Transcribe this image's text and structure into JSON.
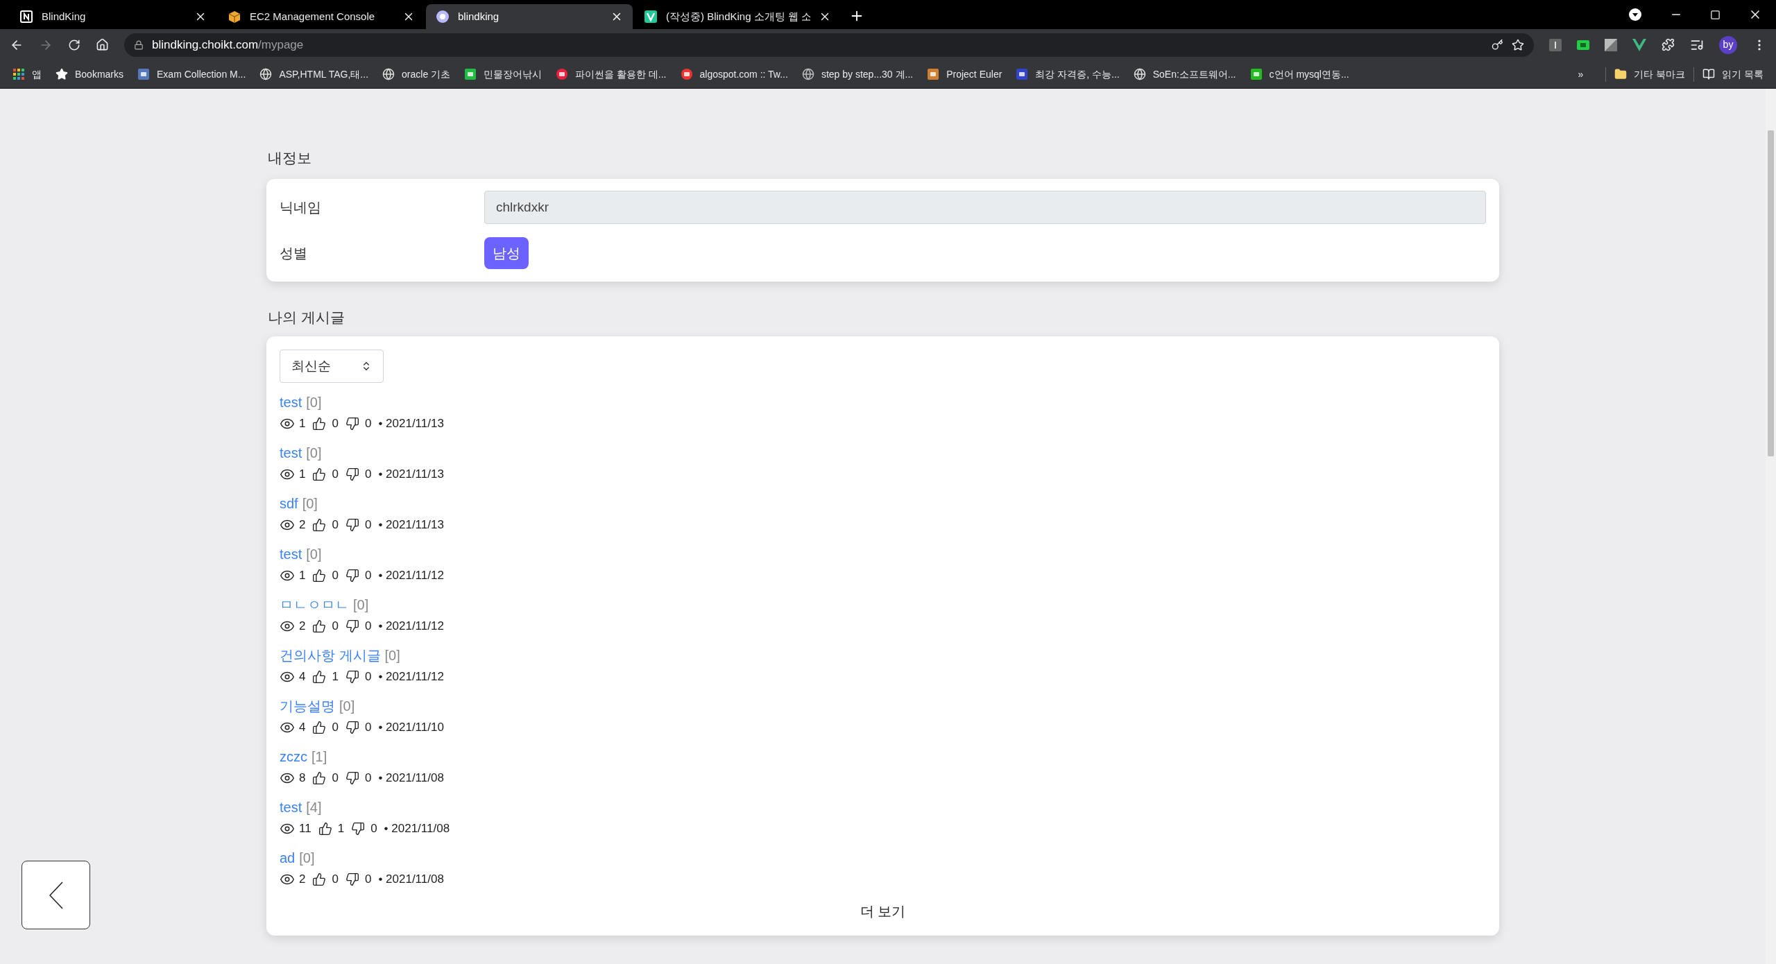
{
  "browser": {
    "tabs": [
      {
        "title": "BlindKing",
        "selected": false
      },
      {
        "title": "EC2 Management Console",
        "selected": false
      },
      {
        "title": "blindking",
        "selected": true
      },
      {
        "title": "(작성중) BlindKing 소개팅 웹 소",
        "selected": false
      }
    ],
    "address": {
      "host": "blindking.choikt.com",
      "path": "/mypage"
    },
    "profile": "by",
    "bookmarks": [
      {
        "label": "앱"
      },
      {
        "label": "Bookmarks"
      },
      {
        "label": "Exam Collection M..."
      },
      {
        "label": "ASP,HTML TAG,태..."
      },
      {
        "label": "oracle 기초"
      },
      {
        "label": "민물장어낚시"
      },
      {
        "label": "파이썬을 활용한 데..."
      },
      {
        "label": "algospot.com :: Tw..."
      },
      {
        "label": "step by step...30 계..."
      },
      {
        "label": "Project Euler"
      },
      {
        "label": "최강 자격증, 수능..."
      },
      {
        "label": "SoEn:소프트웨어..."
      },
      {
        "label": "c언어 mysql연동..."
      }
    ],
    "bookmarks_more": "»",
    "bookmark_folders": [
      {
        "label": "기타 북마크"
      },
      {
        "label": "읽기 목록"
      }
    ]
  },
  "profile_section": {
    "heading": "내정보",
    "nickname": {
      "label": "닉네임",
      "value": "chlrkdxkr"
    },
    "gender": {
      "label": "성별",
      "value": "남성"
    }
  },
  "posts": {
    "heading": "나의 게시글",
    "sort": "최신순",
    "more": "더 보기",
    "items": [
      {
        "title": "test",
        "comments": "[0]",
        "views": "1",
        "likes": "0",
        "dislikes": "0",
        "date": "• 2021/11/13"
      },
      {
        "title": "test",
        "comments": "[0]",
        "views": "1",
        "likes": "0",
        "dislikes": "0",
        "date": "• 2021/11/13"
      },
      {
        "title": "sdf",
        "comments": "[0]",
        "views": "2",
        "likes": "0",
        "dislikes": "0",
        "date": "• 2021/11/13"
      },
      {
        "title": "test",
        "comments": "[0]",
        "views": "1",
        "likes": "0",
        "dislikes": "0",
        "date": "• 2021/11/12"
      },
      {
        "title": "ㅁㄴㅇㅁㄴ",
        "comments": "[0]",
        "views": "2",
        "likes": "0",
        "dislikes": "0",
        "date": "• 2021/11/12"
      },
      {
        "title": "건의사항 게시글",
        "comments": "[0]",
        "views": "4",
        "likes": "1",
        "dislikes": "0",
        "date": "• 2021/11/12"
      },
      {
        "title": "기능설명",
        "comments": "[0]",
        "views": "4",
        "likes": "0",
        "dislikes": "0",
        "date": "• 2021/11/10"
      },
      {
        "title": "zczc",
        "comments": "[1]",
        "views": "8",
        "likes": "0",
        "dislikes": "0",
        "date": "• 2021/11/08"
      },
      {
        "title": "test",
        "comments": "[4]",
        "views": "11",
        "likes": "1",
        "dislikes": "0",
        "date": "• 2021/11/08"
      },
      {
        "title": "ad",
        "comments": "[0]",
        "views": "2",
        "likes": "0",
        "dislikes": "0",
        "date": "• 2021/11/08"
      }
    ]
  }
}
